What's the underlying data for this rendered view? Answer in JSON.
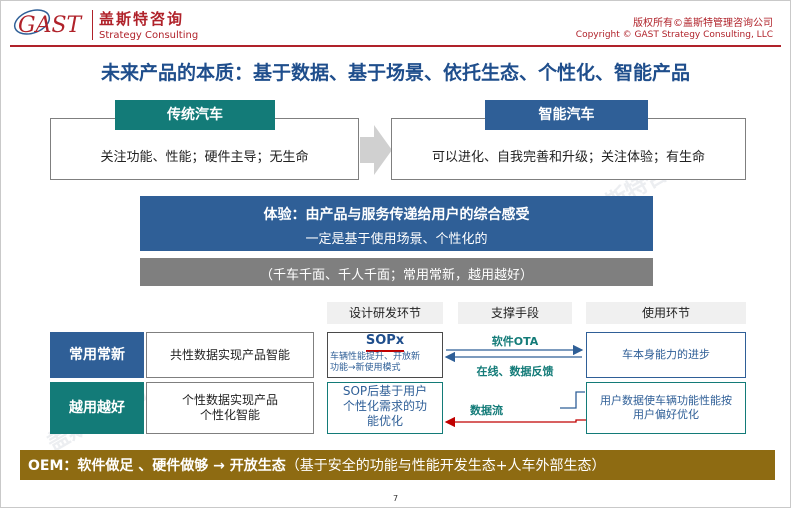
{
  "header": {
    "logo_text": "GAST",
    "brand_cn": "盖斯特咨询",
    "brand_en": "Strategy Consulting",
    "copyright_cn": "版权所有©盖斯特管理咨询公司",
    "copyright_en": "Copyright © GAST Strategy Consulting, LLC"
  },
  "title": "未来产品的本质：基于数据、基于场景、依托生态、个性化、智能产品",
  "traditional": {
    "label": "传统汽车",
    "text": "关注功能、性能；硬件主导；无生命"
  },
  "smart": {
    "label": "智能汽车",
    "text": "可以进化、自我完善和升级；关注体验；有生命"
  },
  "experience": {
    "title": "体验：由产品与服务传递给用户的综合感受",
    "subtitle": "一定是基于使用场景、个性化的",
    "note": "（千车千面、千人千面；常用常新，越用越好）"
  },
  "columns": {
    "design": "设计研发环节",
    "support": "支撑手段",
    "use": "使用环节"
  },
  "rows": {
    "common": {
      "label": "常用常新",
      "desc": "共性数据实现产品智能",
      "design_title": "SOPx",
      "design_line1": "车辆性能提升、开放新",
      "design_line2": "功能→新使用模式",
      "support_top": "软件OTA",
      "support_bottom": "在线、数据反馈",
      "use": "车本身能力的进步"
    },
    "better": {
      "label": "越用越好",
      "desc_line1": "个性数据实现产品",
      "desc_line2": "个性化智能",
      "design_line1": "SOP后基于用户",
      "design_line2": "个性化需求的功",
      "design_line3": "能优化",
      "support": "数据流",
      "use_line1": "用户数据使车辆功能性能按",
      "use_line2": "用户偏好优化"
    }
  },
  "oem": {
    "prefix": "OEM：软件做足 、硬件做够 → 开放生态",
    "suffix": "（基于安全的功能与性能开发生态+人车外部生态）"
  },
  "page_number": "7",
  "watermark": "盖斯特咨询",
  "colors": {
    "brand_red": "#b0222a",
    "title_blue": "#1f4e8c",
    "blue": "#2f5f97",
    "teal": "#137b78",
    "grey": "#7f7f7f",
    "gold": "#8e6b12"
  }
}
